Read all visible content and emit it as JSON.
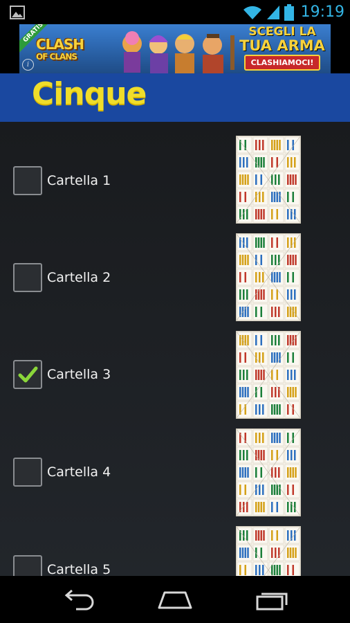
{
  "status_bar": {
    "time": "19:19",
    "icons": [
      "gallery-icon",
      "wifi-icon",
      "signal-icon",
      "battery-icon"
    ]
  },
  "ad": {
    "badge": "GRATIS",
    "logo_line1": "CLASH",
    "logo_line2": "OF CLANS",
    "headline_line1": "SCEGLI LA",
    "headline_line2": "TUA ARMA",
    "cta": "CLASHIAMOCI!",
    "info_icon": "info-icon"
  },
  "action_bar": {
    "title": "Cinque",
    "title_color": "#f0dd2a",
    "background": "#1a48a0"
  },
  "list": {
    "items": [
      {
        "label": "Cartella 1",
        "checked": false
      },
      {
        "label": "Cartella 2",
        "checked": false
      },
      {
        "label": "Cartella 3",
        "checked": true
      },
      {
        "label": "Cartella 4",
        "checked": false
      },
      {
        "label": "Cartella 5",
        "checked": false
      }
    ],
    "check_color": "#8bd63a"
  },
  "nav_bar": {
    "buttons": [
      "back-icon",
      "home-icon",
      "recents-icon"
    ]
  }
}
